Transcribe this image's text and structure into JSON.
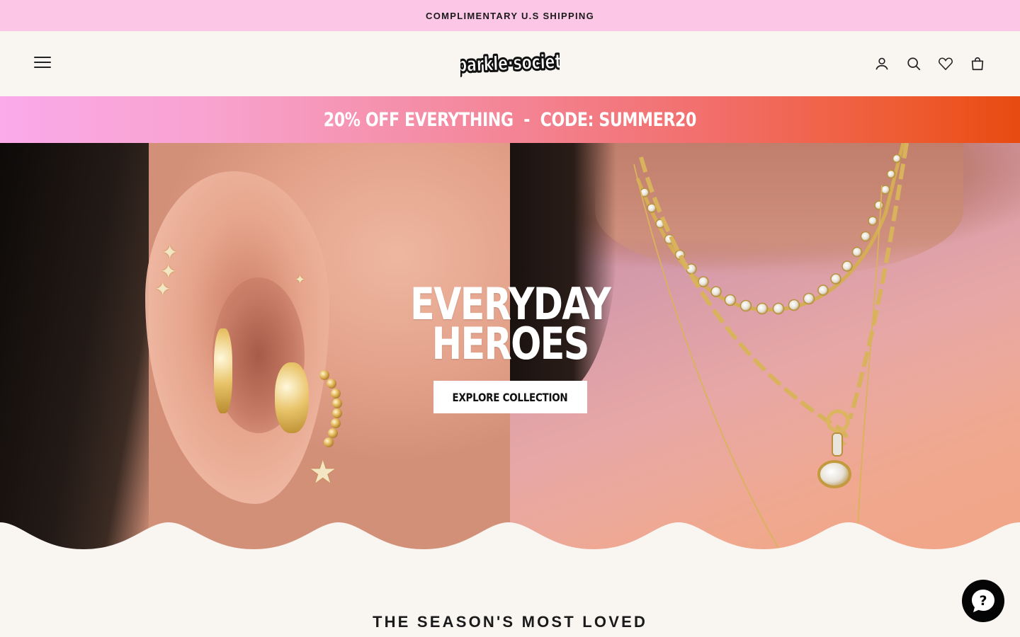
{
  "announcement": {
    "text": "COMPLIMENTARY U.S SHIPPING"
  },
  "header": {
    "logo_text": "sparkle society",
    "icons": [
      "menu-icon",
      "account-icon",
      "search-icon",
      "wishlist-heart-icon",
      "cart-bag-icon"
    ]
  },
  "promo": {
    "text": "20% OFF EVERYTHING  -  CODE: SUMMER20"
  },
  "hero": {
    "title_line1": "EVERYDAY",
    "title_line2": "HEROES",
    "button_label": "EXPLORE COLLECTION"
  },
  "section": {
    "title": "THE SEASON'S MOST LOVED"
  },
  "chat": {
    "icon": "chat-help-icon"
  },
  "colors": {
    "announcement_bg": "#fcc6e6",
    "page_bg": "#f9f6f2",
    "promo_gradient_start": "#fbaaea",
    "promo_gradient_end": "#e84a10",
    "chat_bg": "#050505"
  }
}
